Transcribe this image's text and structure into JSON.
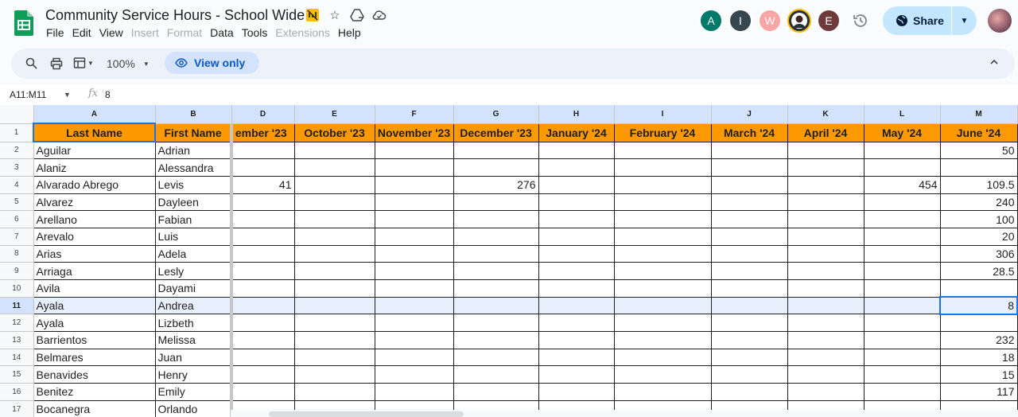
{
  "app": {
    "title": "Community Service Hours - School Wide",
    "menu": [
      {
        "label": "File",
        "disabled": false
      },
      {
        "label": "Edit",
        "disabled": false
      },
      {
        "label": "View",
        "disabled": false
      },
      {
        "label": "Insert",
        "disabled": true
      },
      {
        "label": "Format",
        "disabled": true
      },
      {
        "label": "Data",
        "disabled": false
      },
      {
        "label": "Tools",
        "disabled": false
      },
      {
        "label": "Extensions",
        "disabled": true
      },
      {
        "label": "Help",
        "disabled": false
      }
    ],
    "collaborators": [
      {
        "initial": "A",
        "color": "#00796b"
      },
      {
        "initial": "I",
        "color": "#37474f"
      },
      {
        "initial": "W",
        "color": "#f8a5a5"
      },
      {
        "initial": "",
        "color": "#263238"
      },
      {
        "initial": "E",
        "color": "#6d3b3b"
      }
    ],
    "share_label": "Share"
  },
  "toolbar": {
    "zoom": "100%",
    "view_only_label": "View only"
  },
  "formula_bar": {
    "name_box": "A11:M11",
    "value": "8"
  },
  "sheet": {
    "column_letters": [
      "A",
      "B",
      "D",
      "E",
      "F",
      "G",
      "H",
      "I",
      "J",
      "K",
      "L",
      "M"
    ],
    "header_row": [
      "Last Name",
      "First Name",
      "ember '23",
      "October '23",
      "November '23",
      "December '23",
      "January '24",
      "February '24",
      "March '24",
      "April '24",
      "May '24",
      "June '24"
    ],
    "rows": [
      {
        "n": "2",
        "last": "Aguilar",
        "first": "Adrian",
        "D": "",
        "G": "",
        "L": "",
        "M": "50"
      },
      {
        "n": "3",
        "last": "Alaniz",
        "first": "Alessandra",
        "D": "",
        "G": "",
        "L": "",
        "M": ""
      },
      {
        "n": "4",
        "last": "Alvarado Abrego",
        "first": "Levis",
        "D": "41",
        "G": "276",
        "L": "454",
        "M": "109.5"
      },
      {
        "n": "5",
        "last": "Alvarez",
        "first": "Dayleen",
        "D": "",
        "G": "",
        "L": "",
        "M": "240"
      },
      {
        "n": "6",
        "last": "Arellano",
        "first": "Fabian",
        "D": "",
        "G": "",
        "L": "",
        "M": "100"
      },
      {
        "n": "7",
        "last": "Arevalo",
        "first": "Luis",
        "D": "",
        "G": "",
        "L": "",
        "M": "20"
      },
      {
        "n": "8",
        "last": "Arias",
        "first": "Adela",
        "D": "",
        "G": "",
        "L": "",
        "M": "306"
      },
      {
        "n": "9",
        "last": "Arriaga",
        "first": "Lesly",
        "D": "",
        "G": "",
        "L": "",
        "M": "28.5"
      },
      {
        "n": "10",
        "last": "Avila",
        "first": "Dayami",
        "D": "",
        "G": "",
        "L": "",
        "M": ""
      },
      {
        "n": "11",
        "last": "Ayala",
        "first": "Andrea",
        "D": "",
        "G": "",
        "L": "",
        "M": "8"
      },
      {
        "n": "12",
        "last": "Ayala",
        "first": "Lizbeth",
        "D": "",
        "G": "",
        "L": "",
        "M": ""
      },
      {
        "n": "13",
        "last": "Barrientos",
        "first": "Melissa",
        "D": "",
        "G": "",
        "L": "",
        "M": "232"
      },
      {
        "n": "14",
        "last": "Belmares",
        "first": "Juan",
        "D": "",
        "G": "",
        "L": "",
        "M": "18"
      },
      {
        "n": "15",
        "last": "Benavides",
        "first": "Henry",
        "D": "",
        "G": "",
        "L": "",
        "M": "15"
      },
      {
        "n": "16",
        "last": "Benitez",
        "first": "Emily",
        "D": "",
        "G": "",
        "L": "",
        "M": "117"
      },
      {
        "n": "17",
        "last": "Bocanegra",
        "first": "Orlando",
        "D": "",
        "G": "",
        "L": "",
        "M": ""
      }
    ],
    "selected_row": "11",
    "header_fill": "#ff9900"
  }
}
